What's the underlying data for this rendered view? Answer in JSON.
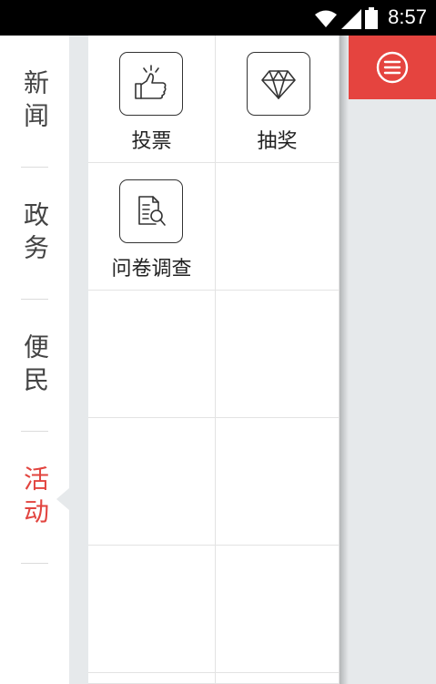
{
  "status": {
    "time": "8:57"
  },
  "nav": {
    "items": [
      {
        "label": "新闻",
        "active": false
      },
      {
        "label": "政务",
        "active": false
      },
      {
        "label": "便民",
        "active": false
      },
      {
        "label": "活动",
        "active": true
      }
    ]
  },
  "activities": [
    {
      "label": "投票",
      "icon": "thumbs-up-icon"
    },
    {
      "label": "抽奖",
      "icon": "diamond-icon"
    },
    {
      "label": "问卷调查",
      "icon": "survey-search-icon"
    }
  ],
  "colors": {
    "accent": "#e5443f",
    "background": "#e6e9eb"
  }
}
